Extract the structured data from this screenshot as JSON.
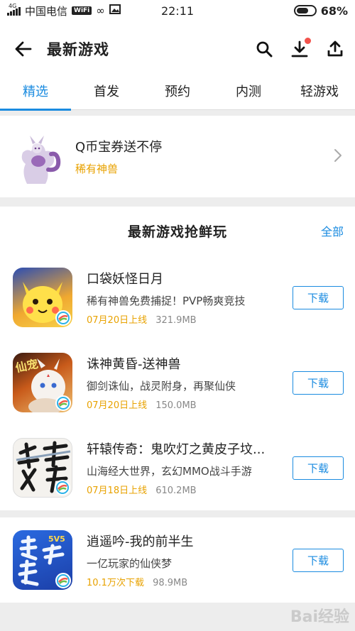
{
  "status_bar": {
    "carrier": "中国电信",
    "net_tag": "4G",
    "wifi_label": "WiFi",
    "time": "22:11",
    "battery": "68%",
    "battery_level": 0.68
  },
  "header": {
    "title": "最新游戏"
  },
  "tabs": [
    {
      "label": "精选",
      "active": true
    },
    {
      "label": "首发",
      "active": false
    },
    {
      "label": "预约",
      "active": false
    },
    {
      "label": "内测",
      "active": false
    },
    {
      "label": "轻游戏",
      "active": false
    }
  ],
  "promo": {
    "title": "Q币宝券送不停",
    "subtitle": "稀有神兽"
  },
  "section": {
    "title": "最新游戏抢鲜玩",
    "all_link": "全部"
  },
  "games": [
    {
      "name": "口袋妖怪日月",
      "desc": "稀有神兽免费捕捉！PVP畅爽竞技",
      "date": "07月20日上线",
      "size": "321.9MB",
      "button": "下载"
    },
    {
      "name": "诛神黄昏-送神兽",
      "desc": "御剑诛仙，战灵附身，再聚仙侠",
      "date": "07月20日上线",
      "size": "150.0MB",
      "button": "下载"
    },
    {
      "name": "轩辕传奇：鬼吹灯之黄皮子坟...",
      "desc": "山海经大世界，玄幻MMO战斗手游",
      "date": "07月18日上线",
      "size": "610.2MB",
      "button": "下载"
    }
  ],
  "featured_game": {
    "name": "逍遥吟-我的前半生",
    "desc": "一亿玩家的仙侠梦",
    "downloads": "10.1万次下载",
    "size": "98.9MB",
    "button": "下载"
  },
  "watermark": "Bai经验",
  "colors": {
    "accent": "#1a8be0",
    "date_orange": "#e8a200",
    "notify_red": "#f2534c"
  }
}
